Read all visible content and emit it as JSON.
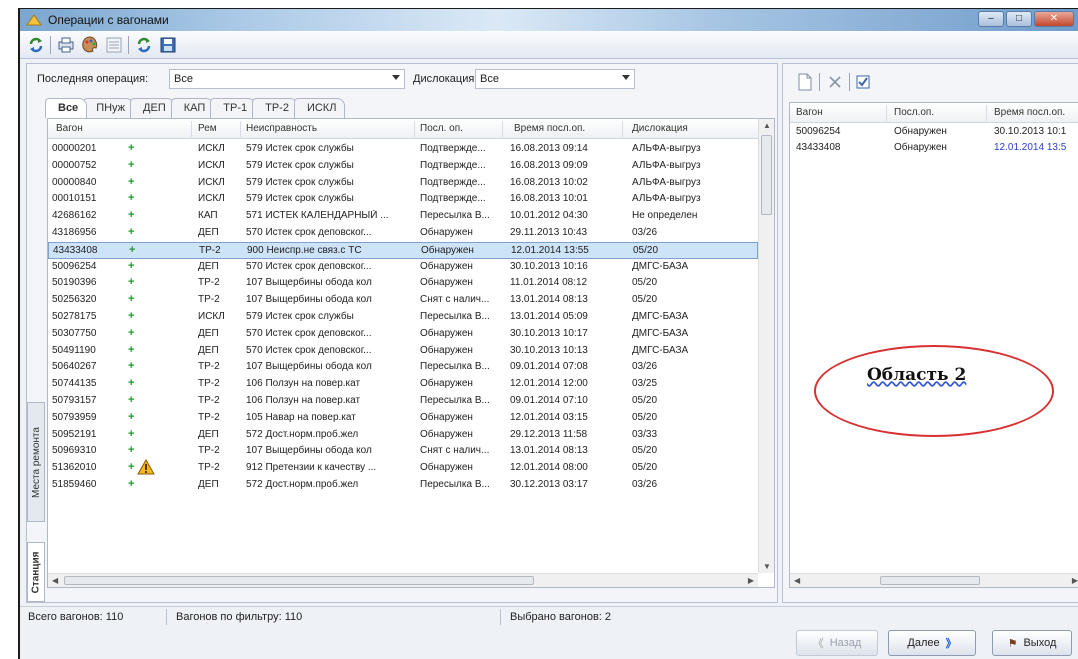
{
  "window": {
    "title": "Операции с вагонами"
  },
  "filters": {
    "last_op_label": "Последняя операция:",
    "last_op_value": "Все",
    "dislocation_label": "Дислокация:",
    "dislocation_value": "Все"
  },
  "tabs": [
    "Все",
    "ПНуж",
    "ДЕП",
    "КАП",
    "ТР-1",
    "ТР-2",
    "ИСКЛ"
  ],
  "side_tabs": [
    "Места ремонта",
    "Станция"
  ],
  "table": {
    "columns": [
      "Вагон",
      "Рем",
      "Неисправность",
      "Посл. оп.",
      "Время посл.оп.",
      "Дислокация"
    ],
    "rows": [
      {
        "wagon": "00000201",
        "plus": "+",
        "rem": "ИСКЛ",
        "fault": "579 Истек срок службы",
        "op": "Подтвержде...",
        "time": "16.08.2013 09:14",
        "disl": "АЛЬФА-выгруз"
      },
      {
        "wagon": "00000752",
        "plus": "+",
        "rem": "ИСКЛ",
        "fault": "579 Истек срок службы",
        "op": "Подтвержде...",
        "time": "16.08.2013 09:09",
        "disl": "АЛЬФА-выгруз"
      },
      {
        "wagon": "00000840",
        "plus": "+",
        "rem": "ИСКЛ",
        "fault": "579 Истек срок службы",
        "op": "Подтвержде...",
        "time": "16.08.2013 10:02",
        "disl": "АЛЬФА-выгруз"
      },
      {
        "wagon": "00010151",
        "plus": "+",
        "rem": "ИСКЛ",
        "fault": "579 Истек срок службы",
        "op": "Подтвержде...",
        "time": "16.08.2013 10:01",
        "disl": "АЛЬФА-выгруз"
      },
      {
        "wagon": "42686162",
        "plus": "+",
        "rem": "КАП",
        "fault": "571 ИСТЕК КАЛЕНДАРНЫЙ ...",
        "op": "Пересылка В...",
        "time": "10.01.2012 04:30",
        "disl": "Не определен"
      },
      {
        "wagon": "43186956",
        "plus": "+",
        "rem": "ДЕП",
        "fault": "570 Истек срок деповског...",
        "op": "Обнаружен",
        "time": "29.11.2013 10:43",
        "disl": "03/26"
      },
      {
        "wagon": "43433408",
        "plus": "+",
        "rem": "ТР-2",
        "fault": "900 Неиспр.не связ.с ТС",
        "op": "Обнаружен",
        "time": "12.01.2014 13:55",
        "disl": "05/20"
      },
      {
        "wagon": "50096254",
        "plus": "+",
        "rem": "ДЕП",
        "fault": "570 Истек срок деповског...",
        "op": "Обнаружен",
        "time": "30.10.2013 10:16",
        "disl": "ДМГС-БАЗА"
      },
      {
        "wagon": "50190396",
        "plus": "+",
        "rem": "ТР-2",
        "fault": "107 Выщербины обода кол",
        "op": "Обнаружен",
        "time": "11.01.2014 08:12",
        "disl": "05/20"
      },
      {
        "wagon": "50256320",
        "plus": "+",
        "rem": "ТР-2",
        "fault": "107 Выщербины обода кол",
        "op": "Снят с налич...",
        "time": "13.01.2014 08:13",
        "disl": "05/20"
      },
      {
        "wagon": "50278175",
        "plus": "+",
        "rem": "ИСКЛ",
        "fault": "579 Истек срок службы",
        "op": "Пересылка В...",
        "time": "13.01.2014 05:09",
        "disl": "ДМГС-БАЗА"
      },
      {
        "wagon": "50307750",
        "plus": "+",
        "rem": "ДЕП",
        "fault": "570 Истек срок деповског...",
        "op": "Обнаружен",
        "time": "30.10.2013 10:17",
        "disl": "ДМГС-БАЗА"
      },
      {
        "wagon": "50491190",
        "plus": "+",
        "rem": "ДЕП",
        "fault": "570 Истек срок деповског...",
        "op": "Обнаружен",
        "time": "30.10.2013 10:13",
        "disl": "ДМГС-БАЗА"
      },
      {
        "wagon": "50640267",
        "plus": "+",
        "rem": "ТР-2",
        "fault": "107 Выщербины обода кол",
        "op": "Пересылка В...",
        "time": "09.01.2014 07:08",
        "disl": "03/26"
      },
      {
        "wagon": "50744135",
        "plus": "+",
        "rem": "ТР-2",
        "fault": "106 Ползун на повер.кат",
        "op": "Обнаружен",
        "time": "12.01.2014 12:00",
        "disl": "03/25"
      },
      {
        "wagon": "50793157",
        "plus": "+",
        "rem": "ТР-2",
        "fault": "106 Ползун на повер.кат",
        "op": "Пересылка В...",
        "time": "09.01.2014 07:10",
        "disl": "05/20"
      },
      {
        "wagon": "50793959",
        "plus": "+",
        "rem": "ТР-2",
        "fault": "105 Навар на повер.кат",
        "op": "Обнаружен",
        "time": "12.01.2014 03:15",
        "disl": "05/20"
      },
      {
        "wagon": "50952191",
        "plus": "+",
        "rem": "ДЕП",
        "fault": "572 Дост.норм.проб.жел",
        "op": "Обнаружен",
        "time": "29.12.2013 11:58",
        "disl": "03/33"
      },
      {
        "wagon": "50969310",
        "plus": "+",
        "rem": "ТР-2",
        "fault": "107 Выщербины обода кол",
        "op": "Снят с налич...",
        "time": "13.01.2014 08:13",
        "disl": "05/20"
      },
      {
        "wagon": "51362010",
        "plus": "+",
        "rem": "ТР-2",
        "fault": "912 Претензии к качеству ...",
        "op": "Обнаружен",
        "time": "12.01.2014 08:00",
        "disl": "05/20"
      },
      {
        "wagon": "51859460",
        "plus": "+",
        "rem": "ДЕП",
        "fault": "572 Дост.норм.проб.жел",
        "op": "Пересылка В...",
        "time": "30.12.2013 03:17",
        "disl": "03/26"
      }
    ]
  },
  "right_table": {
    "columns": [
      "Вагон",
      "Посл.оп.",
      "Время посл.оп."
    ],
    "rows": [
      {
        "wagon": "50096254",
        "op": "Обнаружен",
        "time": "30.10.2013 10:1"
      },
      {
        "wagon": "43433408",
        "op": "Обнаружен",
        "time": "12.01.2014 13:5"
      }
    ]
  },
  "annotation": "Область 2",
  "status": {
    "total": "Всего вагонов: 110",
    "by_filter": "Вагонов по фильтру: 110",
    "selected": "Выбрано вагонов: 2"
  },
  "buttons": {
    "back": "Назад",
    "next": "Далее",
    "exit": "Выход"
  },
  "colors": {
    "selected_row": "#cde3f8",
    "plus_green": "#1d9a2a",
    "ellipse_red": "#d83030",
    "blue_text": "#2a3fc7"
  }
}
